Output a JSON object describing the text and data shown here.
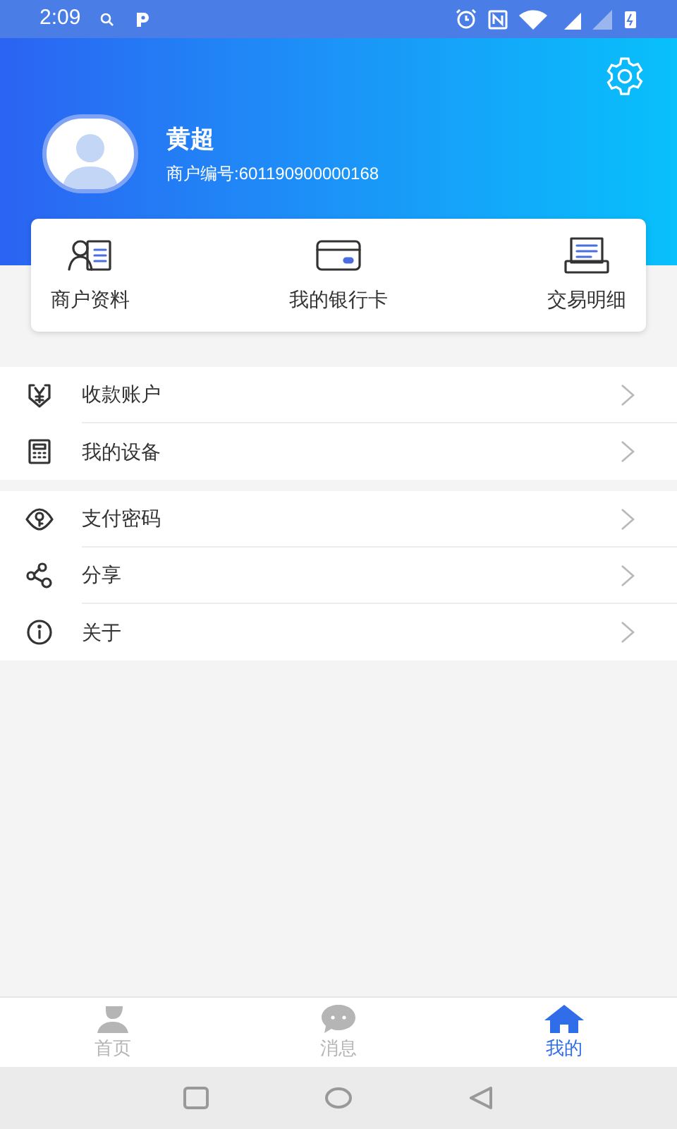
{
  "status_bar": {
    "time": "2:09"
  },
  "profile": {
    "name": "黄超",
    "merchant_no": "商户编号:601190900000168"
  },
  "shortcuts": [
    {
      "label": "商户资料"
    },
    {
      "label": "我的银行卡"
    },
    {
      "label": "交易明细"
    }
  ],
  "menu_groups": [
    [
      {
        "label": "收款账户"
      },
      {
        "label": "我的设备"
      }
    ],
    [
      {
        "label": "支付密码"
      },
      {
        "label": "分享"
      },
      {
        "label": "关于"
      }
    ]
  ],
  "tab_bar": [
    {
      "label": "首页",
      "selected": false
    },
    {
      "label": "消息",
      "selected": false
    },
    {
      "label": "我的",
      "selected": true
    }
  ]
}
